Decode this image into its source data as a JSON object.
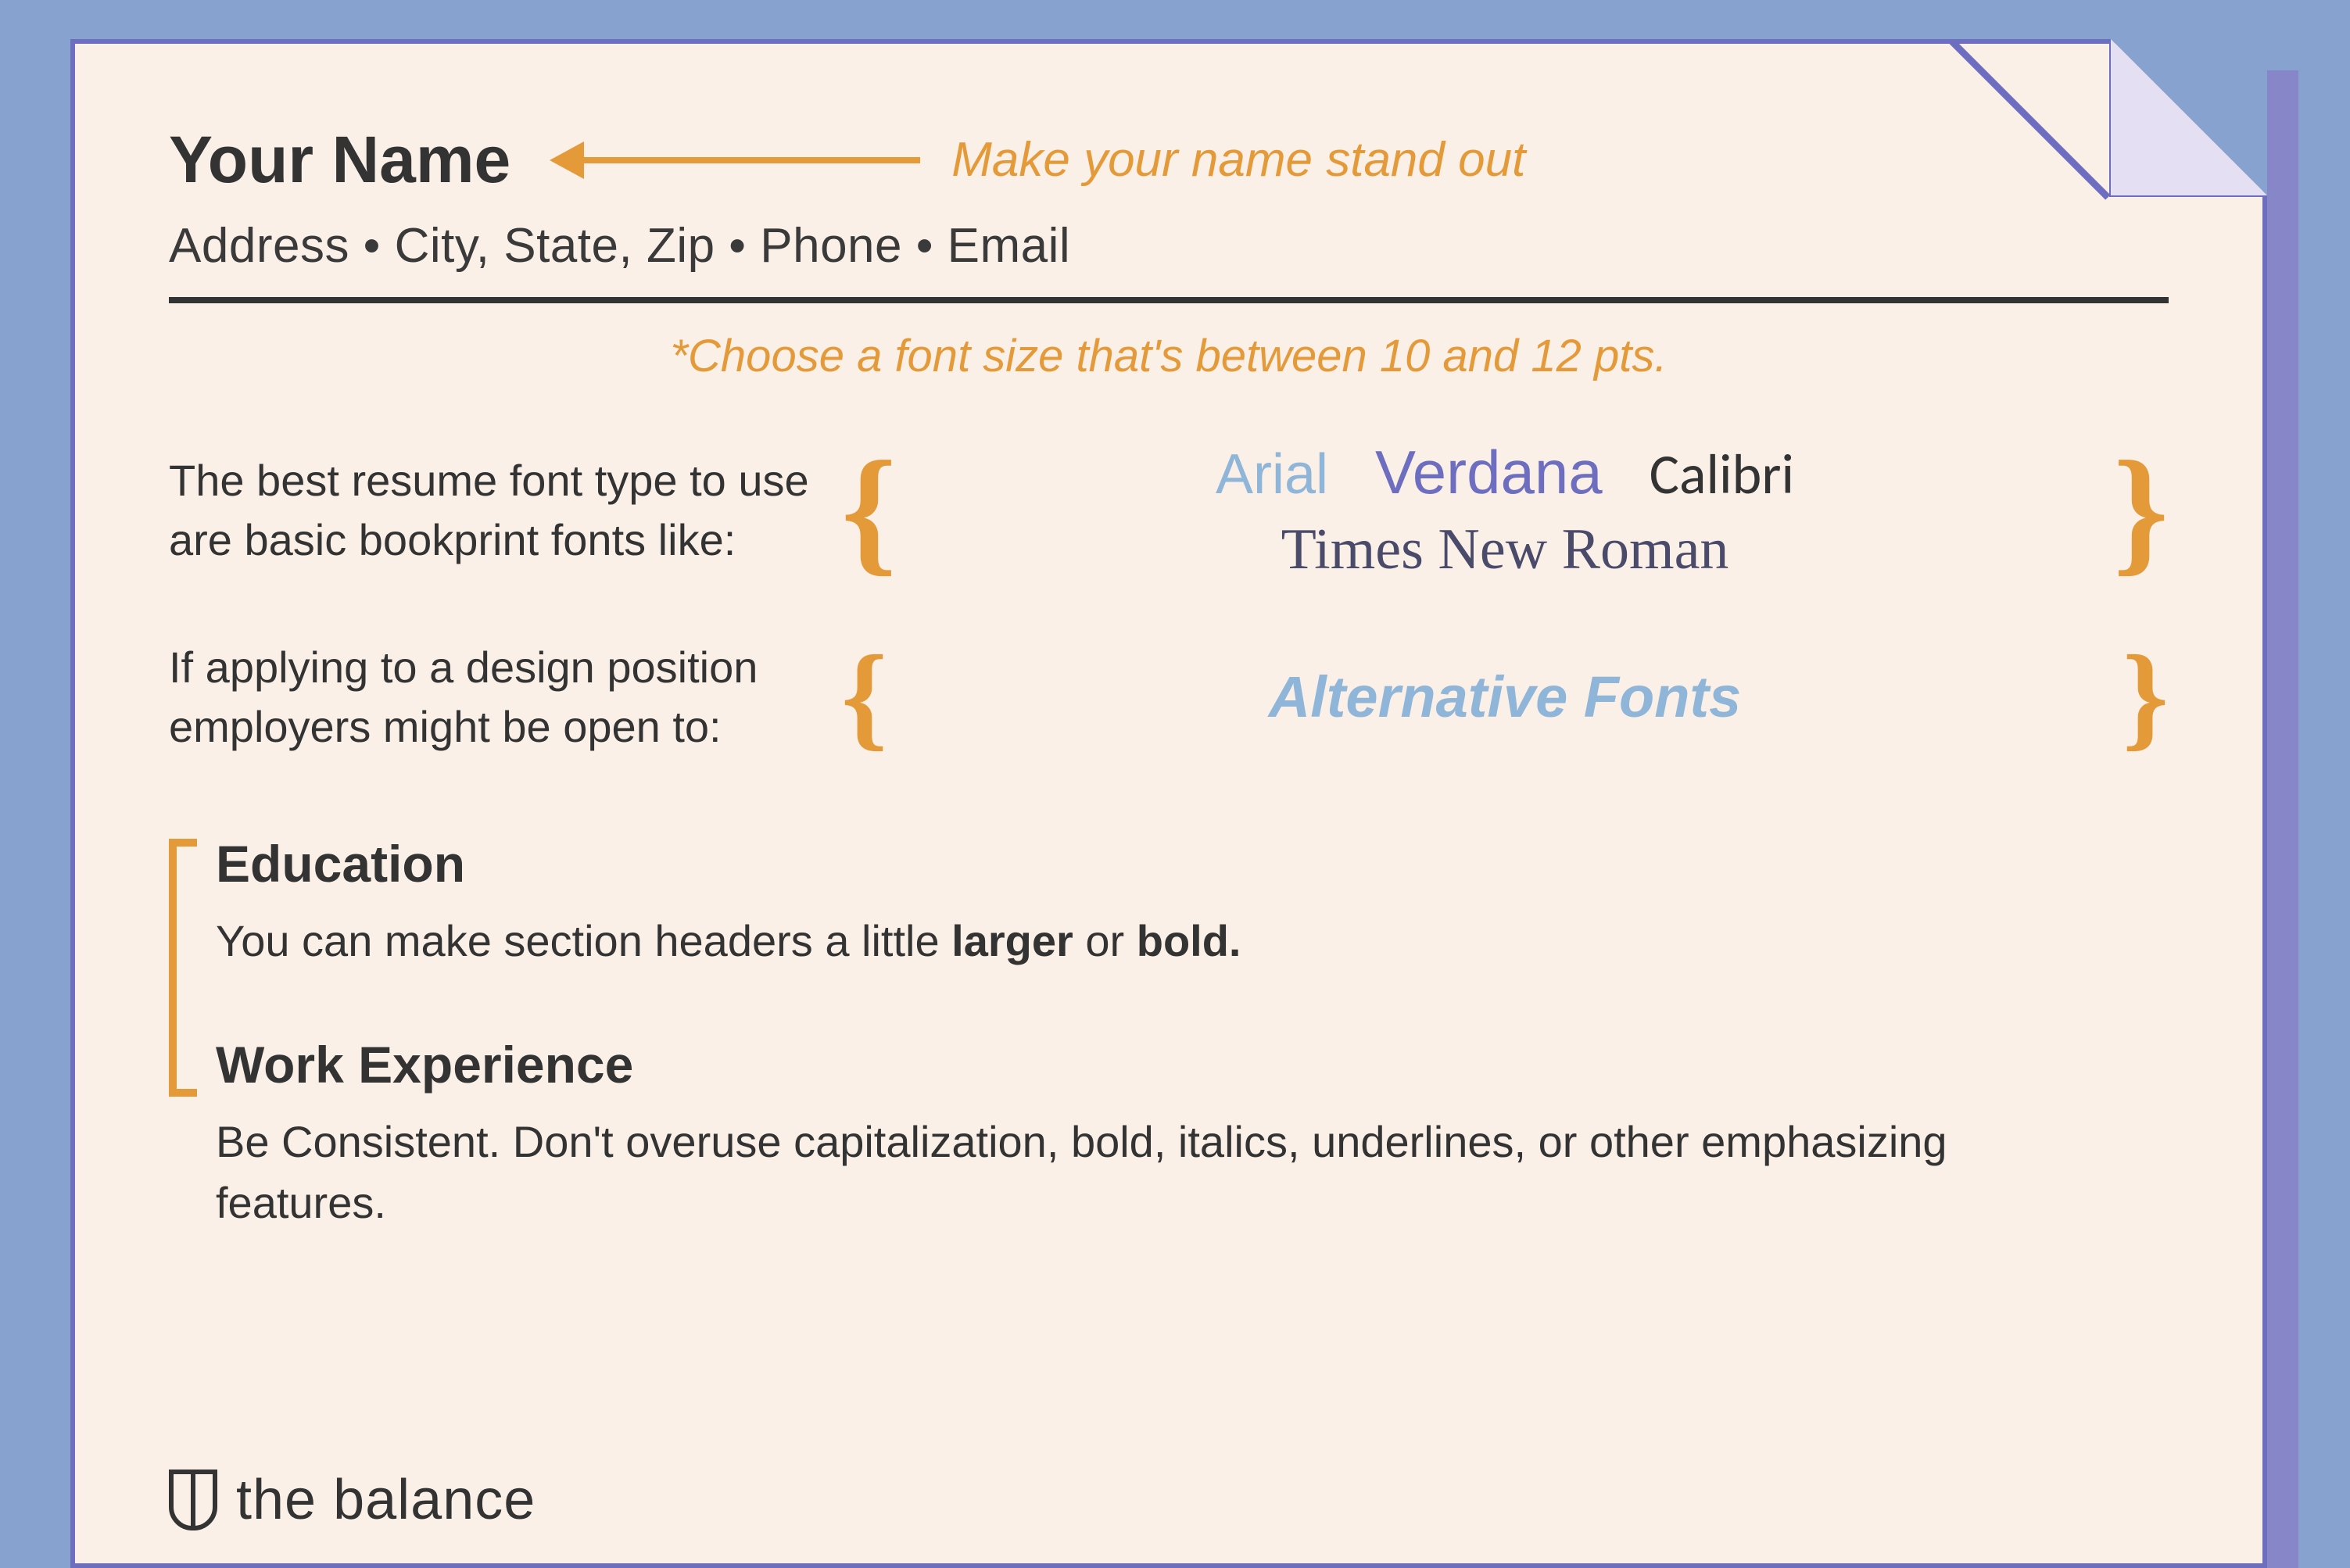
{
  "header": {
    "name": "Your Name",
    "callout": "Make your name stand out",
    "contact": "Address  •  City, State, Zip  •  Phone  •  Email"
  },
  "fontsize_note": "*Choose a font size that's between 10 and 12 pts.",
  "fonts": {
    "best_intro": "The best resume font type to use are basic bookprint fonts like:",
    "list": {
      "arial": "Arial",
      "verdana": "Verdana",
      "calibri": "Calibri",
      "times": "Times New Roman"
    },
    "alt_intro": "If applying to a design position employers might be open to:",
    "alt_label": "Alternative Fonts"
  },
  "sections": {
    "education": {
      "heading": "Education",
      "text_pre": "You can make section headers a little ",
      "text_bold1": "larger",
      "text_mid": " or ",
      "text_bold2": "bold."
    },
    "work": {
      "heading": "Work Experience",
      "text": "Be Consistent. Don't overuse capitalization, bold, italics, underlines, or other emphasizing features."
    }
  },
  "brand": "the balance"
}
